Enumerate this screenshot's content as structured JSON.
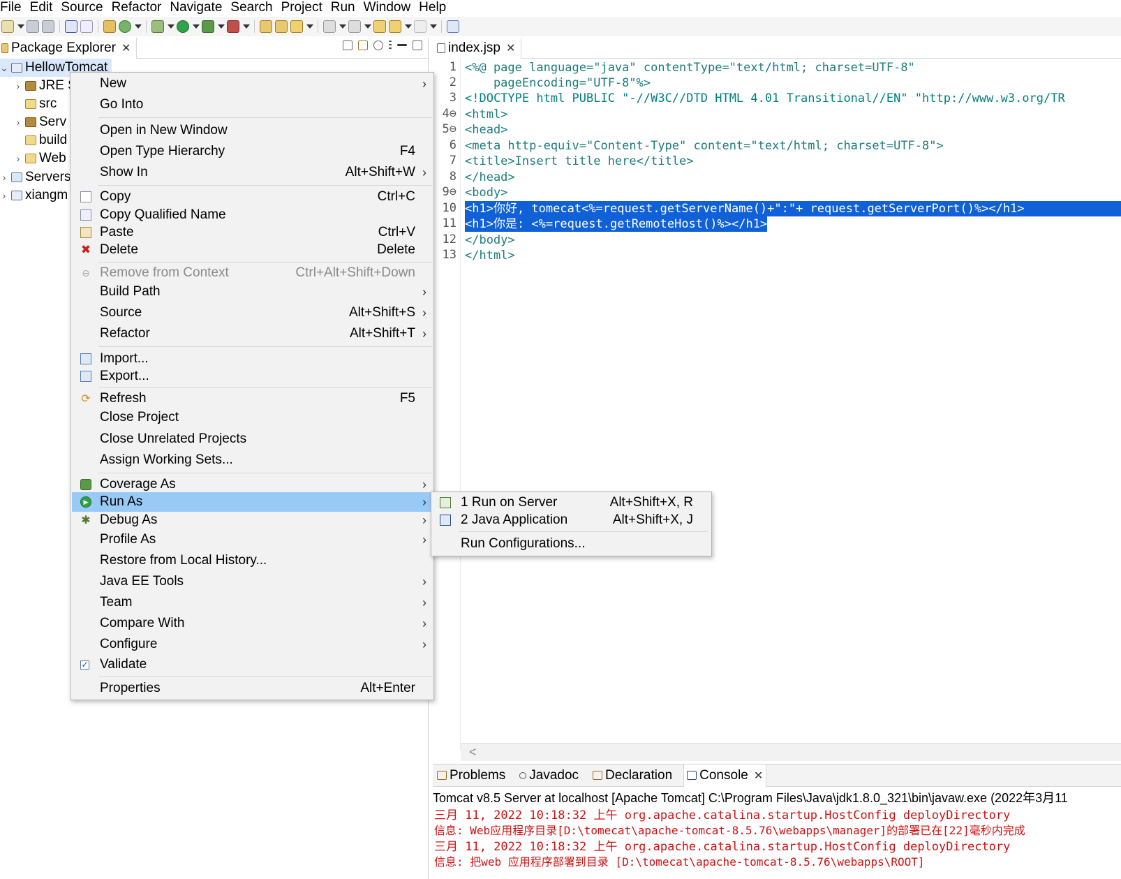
{
  "menubar": [
    "File",
    "Edit",
    "Source",
    "Refactor",
    "Navigate",
    "Search",
    "Project",
    "Run",
    "Window",
    "Help"
  ],
  "package_explorer": {
    "tab_label": "Package Explorer",
    "tree": [
      {
        "label": "HellowTomcat",
        "twisty": "⌄",
        "icon": "project-icon"
      },
      {
        "label": "JRE S",
        "twisty": "›",
        "icon": "library-icon"
      },
      {
        "label": "src",
        "twisty": "",
        "icon": "source-folder-icon"
      },
      {
        "label": "Serv",
        "twisty": "›",
        "icon": "library-icon"
      },
      {
        "label": "build",
        "twisty": "",
        "icon": "folder-icon"
      },
      {
        "label": "Web",
        "twisty": "›",
        "icon": "folder-icon"
      },
      {
        "label": "Servers",
        "twisty": "›",
        "icon": "project-icon"
      },
      {
        "label": "xiangm",
        "twisty": "›",
        "icon": "project-icon"
      }
    ]
  },
  "editor": {
    "tab_label": "index.jsp",
    "lines": [
      {
        "n": "1",
        "text": "<%@ page language=\"java\" contentType=\"text/html; charset=UTF-8\""
      },
      {
        "n": "2",
        "text": "    pageEncoding=\"UTF-8\"%>"
      },
      {
        "n": "3",
        "text": "<!DOCTYPE html PUBLIC \"-//W3C//DTD HTML 4.01 Transitional//EN\" \"http://www.w3.org/TR"
      },
      {
        "n": "4⊖",
        "text": "<html>"
      },
      {
        "n": "5⊖",
        "text": "<head>"
      },
      {
        "n": "6",
        "text": "<meta http-equiv=\"Content-Type\" content=\"text/html; charset=UTF-8\">"
      },
      {
        "n": "7",
        "text": "<title>Insert title here</title>"
      },
      {
        "n": "8",
        "text": "</head>"
      },
      {
        "n": "9⊖",
        "text": "<body>"
      },
      {
        "n": "10",
        "text": "<h1>你好, tomecat<%=request.getServerName()+\":\"+ request.getServerPort()%></h1>"
      },
      {
        "n": "11",
        "text": "<h1>你是: <%=request.getRemoteHost()%></h1>"
      },
      {
        "n": "12",
        "text": "</body>"
      },
      {
        "n": "13",
        "text": "</html>"
      }
    ],
    "scroll_left_glyph": "<"
  },
  "context_menu": {
    "items": [
      {
        "label": "New",
        "shortcut": "",
        "submenu": true,
        "icon": "",
        "disabled": false
      },
      {
        "label": "Go Into",
        "shortcut": "",
        "submenu": false,
        "icon": "",
        "disabled": false
      },
      {
        "label": "Open in New Window",
        "shortcut": "",
        "submenu": false,
        "icon": "",
        "disabled": false
      },
      {
        "label": "Open Type Hierarchy",
        "shortcut": "F4",
        "submenu": false,
        "icon": "",
        "disabled": false
      },
      {
        "label": "Show In",
        "shortcut": "Alt+Shift+W",
        "submenu": true,
        "icon": "",
        "disabled": false
      },
      {
        "label": "Copy",
        "shortcut": "Ctrl+C",
        "submenu": false,
        "icon": "copy-icon",
        "disabled": false
      },
      {
        "label": "Copy Qualified Name",
        "shortcut": "",
        "submenu": false,
        "icon": "copy-qualified-icon",
        "disabled": false
      },
      {
        "label": "Paste",
        "shortcut": "Ctrl+V",
        "submenu": false,
        "icon": "paste-icon",
        "disabled": false
      },
      {
        "label": "Delete",
        "shortcut": "Delete",
        "submenu": false,
        "icon": "delete-icon",
        "disabled": false
      },
      {
        "label": "Remove from Context",
        "shortcut": "Ctrl+Alt+Shift+Down",
        "submenu": false,
        "icon": "remove-context-icon",
        "disabled": true
      },
      {
        "label": "Build Path",
        "shortcut": "",
        "submenu": true,
        "icon": "",
        "disabled": false
      },
      {
        "label": "Source",
        "shortcut": "Alt+Shift+S",
        "submenu": true,
        "icon": "",
        "disabled": false
      },
      {
        "label": "Refactor",
        "shortcut": "Alt+Shift+T",
        "submenu": true,
        "icon": "",
        "disabled": false
      },
      {
        "label": "Import...",
        "shortcut": "",
        "submenu": false,
        "icon": "import-icon",
        "disabled": false
      },
      {
        "label": "Export...",
        "shortcut": "",
        "submenu": false,
        "icon": "export-icon",
        "disabled": false
      },
      {
        "label": "Refresh",
        "shortcut": "F5",
        "submenu": false,
        "icon": "refresh-icon",
        "disabled": false
      },
      {
        "label": "Close Project",
        "shortcut": "",
        "submenu": false,
        "icon": "",
        "disabled": false
      },
      {
        "label": "Close Unrelated Projects",
        "shortcut": "",
        "submenu": false,
        "icon": "",
        "disabled": false
      },
      {
        "label": "Assign Working Sets...",
        "shortcut": "",
        "submenu": false,
        "icon": "",
        "disabled": false
      },
      {
        "label": "Coverage As",
        "shortcut": "",
        "submenu": true,
        "icon": "coverage-icon",
        "disabled": false
      },
      {
        "label": "Run As",
        "shortcut": "",
        "submenu": true,
        "icon": "run-icon",
        "disabled": false,
        "highlighted": true
      },
      {
        "label": "Debug As",
        "shortcut": "",
        "submenu": true,
        "icon": "debug-icon",
        "disabled": false
      },
      {
        "label": "Profile As",
        "shortcut": "",
        "submenu": true,
        "icon": "",
        "disabled": false
      },
      {
        "label": "Restore from Local History...",
        "shortcut": "",
        "submenu": false,
        "icon": "",
        "disabled": false
      },
      {
        "label": "Java EE Tools",
        "shortcut": "",
        "submenu": true,
        "icon": "",
        "disabled": false
      },
      {
        "label": "Team",
        "shortcut": "",
        "submenu": true,
        "icon": "",
        "disabled": false
      },
      {
        "label": "Compare With",
        "shortcut": "",
        "submenu": true,
        "icon": "",
        "disabled": false
      },
      {
        "label": "Configure",
        "shortcut": "",
        "submenu": true,
        "icon": "",
        "disabled": false
      },
      {
        "label": "Validate",
        "shortcut": "",
        "submenu": false,
        "icon": "validate-check-icon",
        "disabled": false
      },
      {
        "label": "Properties",
        "shortcut": "Alt+Enter",
        "submenu": false,
        "icon": "",
        "disabled": false
      }
    ]
  },
  "run_as_submenu": {
    "items": [
      {
        "label": "1 Run on Server",
        "shortcut": "Alt+Shift+X, R",
        "icon": "run-on-server-icon"
      },
      {
        "label": "2 Java Application",
        "shortcut": "Alt+Shift+X, J",
        "icon": "java-application-icon"
      },
      {
        "label": "Run Configurations...",
        "shortcut": "",
        "icon": ""
      }
    ]
  },
  "console": {
    "tabs": [
      {
        "label": "Problems",
        "icon": "problems-icon",
        "active": false
      },
      {
        "label": "Javadoc",
        "icon": "javadoc-icon",
        "active": false
      },
      {
        "label": "Declaration",
        "icon": "declaration-icon",
        "active": false
      },
      {
        "label": "Console",
        "icon": "console-icon",
        "active": true
      }
    ],
    "title": "Tomcat v8.5 Server at localhost [Apache Tomcat] C:\\Program Files\\Java\\jdk1.8.0_321\\bin\\javaw.exe  (2022年3月11",
    "lines": [
      "三月 11, 2022 10:18:32 上午 org.apache.catalina.startup.HostConfig deployDirectory",
      "信息: Web应用程序目录[D:\\tomecat\\apache-tomcat-8.5.76\\webapps\\manager]的部署已在[22]毫秒内完成",
      "三月 11, 2022 10:18:32 上午 org.apache.catalina.startup.HostConfig deployDirectory",
      "信息: 把web 应用程序部署到目录 [D:\\tomecat\\apache-tomcat-8.5.76\\webapps\\ROOT]"
    ]
  },
  "colors": {
    "selection": "#1060d8",
    "menu_highlight": "#99c9f5",
    "console_text": "#d01010"
  }
}
